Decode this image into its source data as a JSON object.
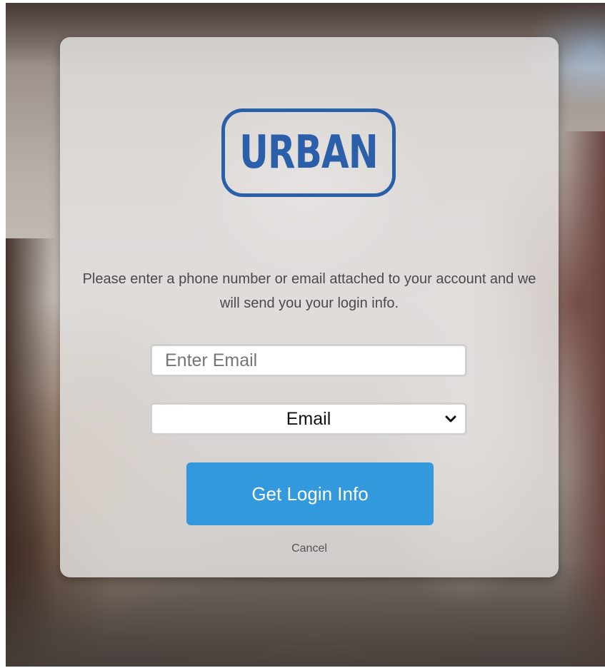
{
  "logo": {
    "text": "URBAN",
    "color": "#2b5faa"
  },
  "instructions": {
    "text": "Please enter a phone number or email attached to your account and we will send you your login info."
  },
  "email_input": {
    "value": "",
    "placeholder": "Enter Email"
  },
  "method_select": {
    "selected": "Email",
    "icon": "chevron-down-icon"
  },
  "submit_button": {
    "label": "Get Login Info",
    "color": "#3399dd"
  },
  "cancel_link": {
    "label": "Cancel"
  }
}
